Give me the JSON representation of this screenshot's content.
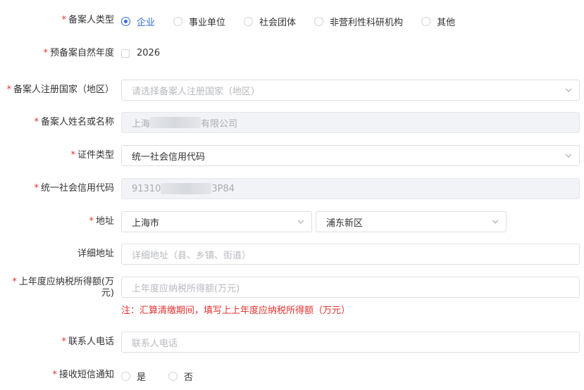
{
  "fields": {
    "filer_type": {
      "label": "备案人类型",
      "options": [
        "企业",
        "事业单位",
        "社会团体",
        "非营利性科研机构",
        "其他"
      ],
      "selected": "企业"
    },
    "filing_year": {
      "label": "预备案自然年度",
      "value": "2026"
    },
    "country": {
      "label": "备案人注册国家（地区）",
      "placeholder": "请选择备案人注册国家（地区）"
    },
    "name": {
      "label": "备案人姓名或名称",
      "prefix": "上海",
      "suffix": "有限公司"
    },
    "id_type": {
      "label": "证件类型",
      "value": "统一社会信用代码"
    },
    "credit_code": {
      "label": "统一社会信用代码",
      "prefix": "91310",
      "suffix": "3P84"
    },
    "address": {
      "label": "地址",
      "province": "上海市",
      "district": "浦东新区"
    },
    "detail_address": {
      "label": "详细地址",
      "placeholder": "详细地址（县、乡镇、街道）"
    },
    "taxable_income": {
      "label_line1": "上年度应纳税所得额(万",
      "label_line2": "元)",
      "placeholder": "上年度应纳税所得额(万元)",
      "note": "注：汇算清缴期间，填写上上年度应纳税所得额（万元）"
    },
    "contact_phone": {
      "label": "联系人电话",
      "placeholder": "联系人电话"
    },
    "sms_notice": {
      "label": "接收短信通知",
      "options": [
        "是",
        "否"
      ]
    }
  },
  "colors": {
    "primary": "#2f6bd8",
    "required": "#e5322d",
    "note": "#e5322d"
  }
}
